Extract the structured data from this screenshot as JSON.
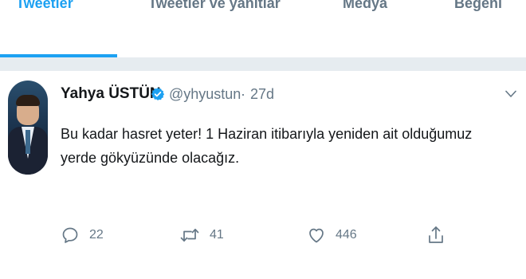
{
  "tabs": [
    {
      "label": "Tweetler",
      "active": true
    },
    {
      "label": "Tweetler ve yanıtlar",
      "active": false
    },
    {
      "label": "Medya",
      "active": false
    },
    {
      "label": "Beğeni",
      "active": false
    }
  ],
  "tweet": {
    "author_name": "Yahya ÜSTÜN",
    "verified": true,
    "handle": "@yhyustun",
    "separator": "·",
    "time": "27d",
    "text": "Bu kadar hasret yeter! 1 Haziran itibarıyla yeniden ait olduğumuz yerde gökyüzünde olacağız.",
    "replies": "22",
    "retweets": "41",
    "likes": "446"
  },
  "icons": {
    "reply": "comment-bubble-icon",
    "retweet": "retweet-icon",
    "like": "heart-icon",
    "share": "share-icon",
    "menu": "chevron-down-icon",
    "verified": "verified-badge-icon"
  },
  "colors": {
    "accent": "#1da1f2",
    "secondary_text": "#657786",
    "primary_text": "#14171a",
    "divider": "#e6ecf0"
  }
}
